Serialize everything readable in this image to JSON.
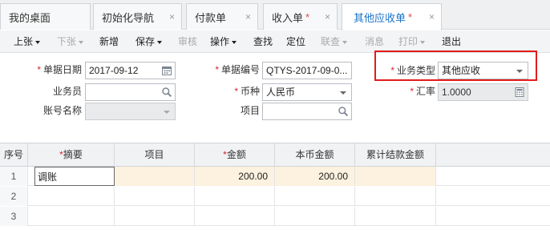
{
  "tabs": [
    {
      "label": "我的桌面",
      "star": "",
      "closable": false,
      "active": false
    },
    {
      "label": "初始化导航",
      "star": "",
      "closable": true,
      "active": false
    },
    {
      "label": "付款单",
      "star": "",
      "closable": true,
      "active": false
    },
    {
      "label": "收入单",
      "star": "*",
      "closable": true,
      "active": false
    },
    {
      "label": "其他应收单",
      "star": "*",
      "closable": true,
      "active": true
    }
  ],
  "tab_close_glyph": "×",
  "toolbar": {
    "prev": "上张",
    "next": "下张",
    "add": "新增",
    "save": "保存",
    "audit": "审核",
    "operate": "操作",
    "find": "查找",
    "locate": "定位",
    "lookup": "联查",
    "message": "消息",
    "print": "打印",
    "exit": "退出"
  },
  "form": {
    "date": {
      "label": "单据日期",
      "required": "*",
      "value": "2017-09-12"
    },
    "salesman": {
      "label": "业务员",
      "value": ""
    },
    "account": {
      "label": "账号名称",
      "value": ""
    },
    "doc_no": {
      "label": "单据编号",
      "required": "*",
      "value": "QTYS-2017-09-0..."
    },
    "currency": {
      "label": "币种",
      "required": "*",
      "value": "人民币"
    },
    "project": {
      "label": "项目",
      "value": ""
    },
    "biz_type": {
      "label": "业务类型",
      "required": "*",
      "value": "其他应收"
    },
    "rate": {
      "label": "汇率",
      "required": "*",
      "value": "1.0000"
    }
  },
  "grid": {
    "columns": [
      {
        "label": "序号",
        "required": ""
      },
      {
        "label": "摘要",
        "required": "*"
      },
      {
        "label": "项目",
        "required": ""
      },
      {
        "label": "金额",
        "required": "*"
      },
      {
        "label": "本币金额",
        "required": ""
      },
      {
        "label": "累计结款金额",
        "required": ""
      }
    ],
    "rows": [
      {
        "index": "1",
        "summary": "调账",
        "project": "",
        "amount": "200.00",
        "local_amount": "200.00",
        "settled": ""
      },
      {
        "index": "2",
        "summary": "",
        "project": "",
        "amount": "",
        "local_amount": "",
        "settled": ""
      },
      {
        "index": "3",
        "summary": "",
        "project": "",
        "amount": "",
        "local_amount": "",
        "settled": ""
      }
    ]
  },
  "icons": {
    "calendar": "calendar-icon",
    "search": "search-icon",
    "dropdown": "chevron-down-icon",
    "calculator": "calculator-icon"
  },
  "colors": {
    "accent": "#1a73c9",
    "required": "#d9262d",
    "highlight_box": "#e21c1c",
    "selected_row": "#fdf1df"
  }
}
